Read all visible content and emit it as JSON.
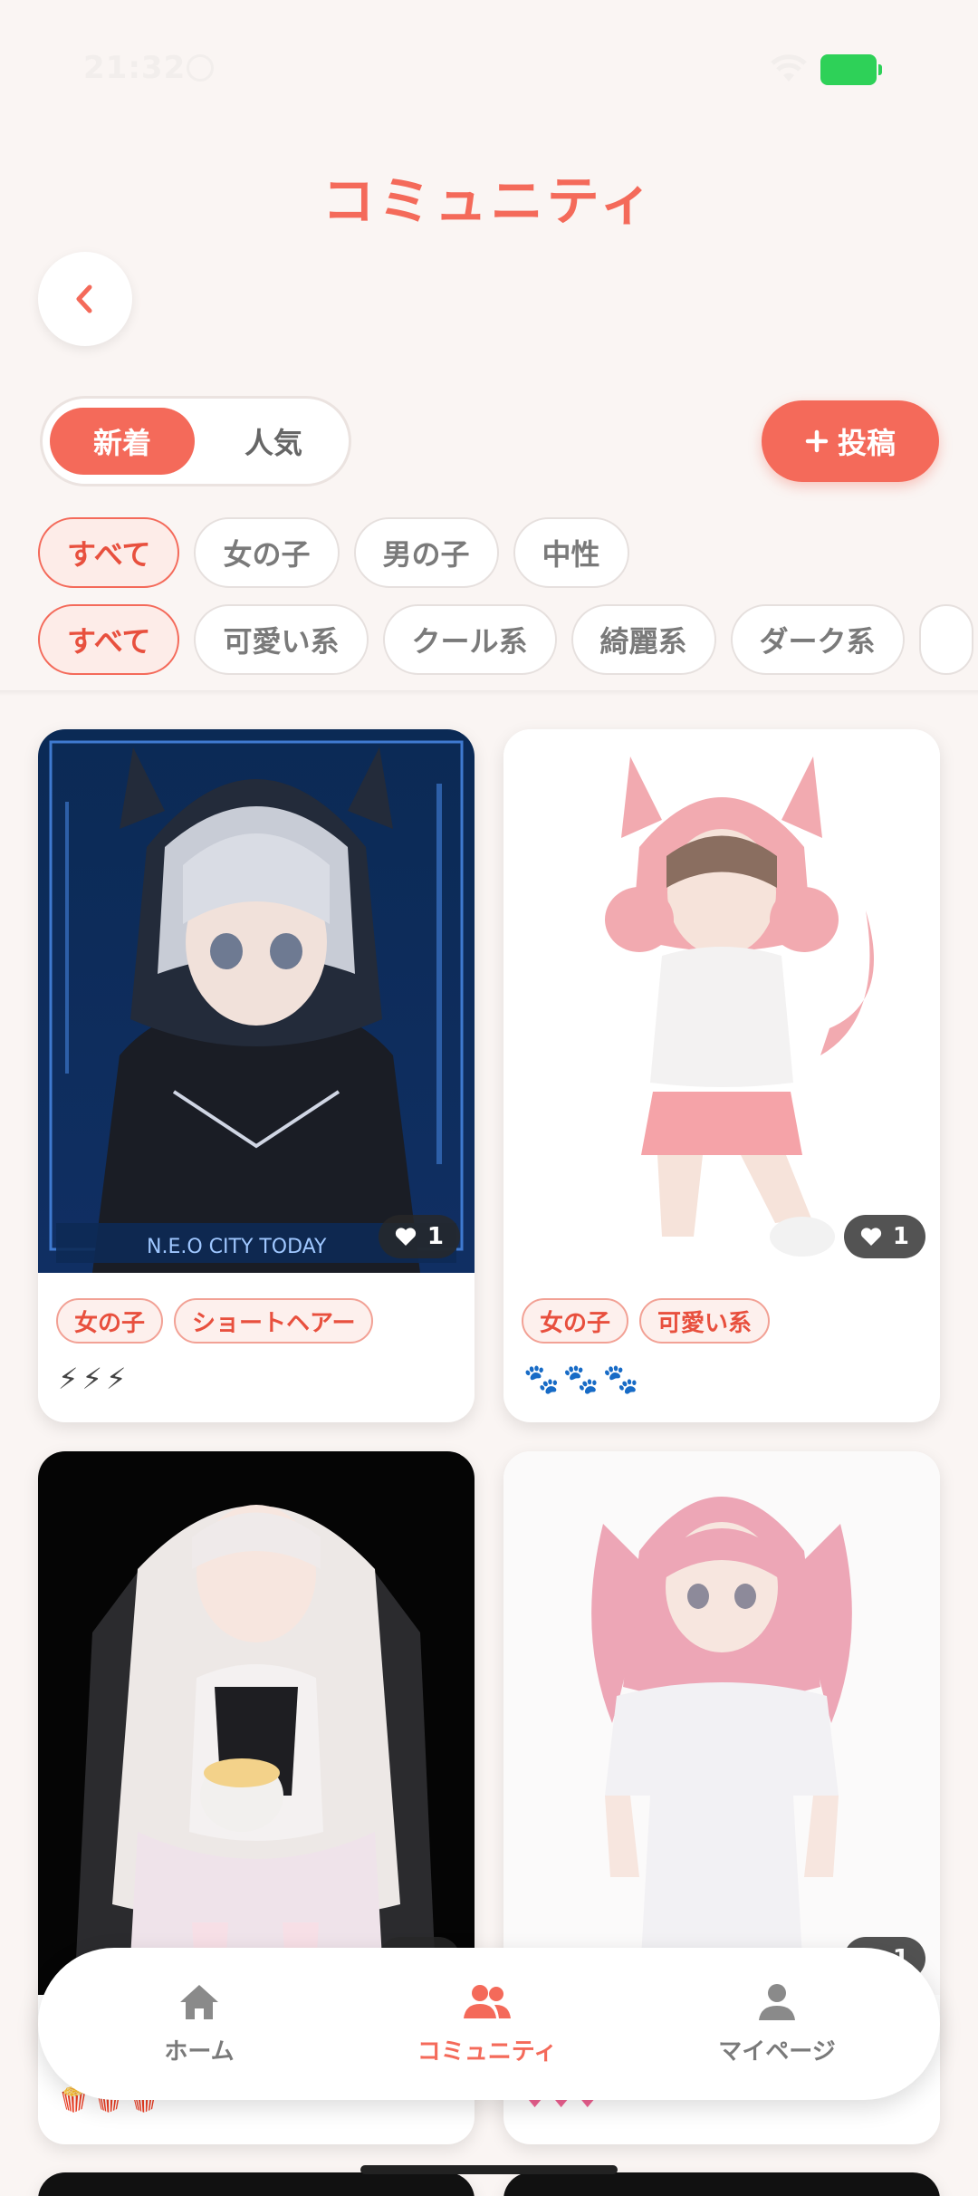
{
  "status_bar": {
    "time": "21:32"
  },
  "header": {
    "title": "コミュニティ"
  },
  "sort": {
    "options": [
      "新着",
      "人気"
    ],
    "selected": "新着"
  },
  "post_button": {
    "label": "投稿"
  },
  "gender_filter": {
    "options": [
      "すべて",
      "女の子",
      "男の子",
      "中性"
    ],
    "selected": "すべて"
  },
  "style_filter": {
    "options": [
      "すべて",
      "可愛い系",
      "クール系",
      "綺麗系",
      "ダーク系"
    ],
    "selected": "すべて"
  },
  "posts": [
    {
      "tags": [
        "女の子",
        "ショートヘアー"
      ],
      "emoji": "⚡⚡⚡",
      "likes": "1",
      "image_text": "N.E.O CITY TODAY"
    },
    {
      "tags": [
        "女の子",
        "可愛い系"
      ],
      "emoji": "🐾🐾🐾",
      "likes": "1"
    },
    {
      "tags": [],
      "emoji": "",
      "likes": "1"
    },
    {
      "tags": [],
      "emoji": "",
      "likes": "1"
    }
  ],
  "bottom_nav": {
    "items": [
      {
        "label": "ホーム",
        "icon": "home-icon"
      },
      {
        "label": "コミュニティ",
        "icon": "people-icon"
      },
      {
        "label": "マイページ",
        "icon": "person-icon"
      }
    ],
    "active": "コミュニティ"
  },
  "colors": {
    "accent": "#f46a5a",
    "background": "#faf5f3",
    "battery": "#2ed158"
  }
}
